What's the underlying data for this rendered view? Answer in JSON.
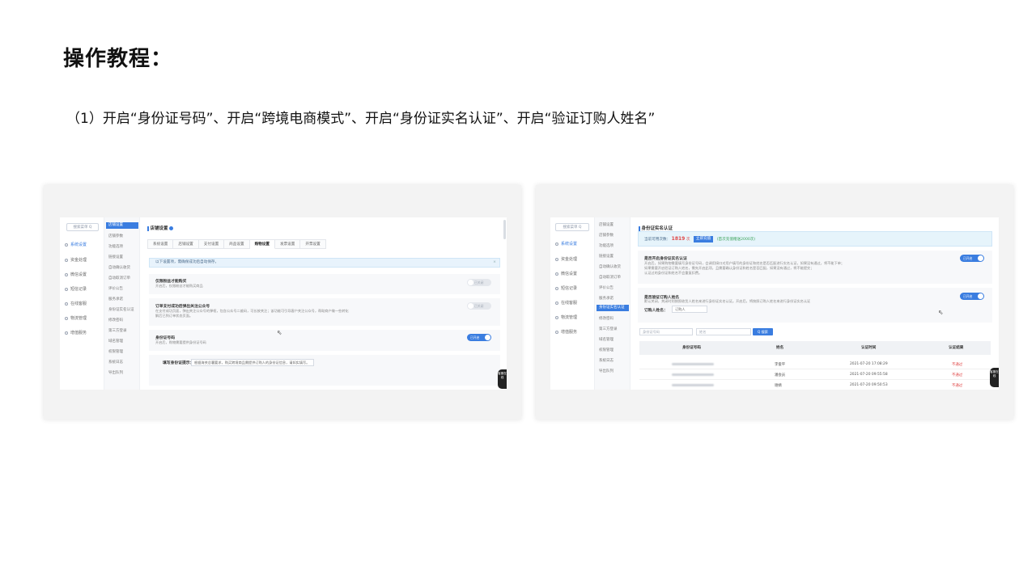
{
  "slide": {
    "title": "操作教程：",
    "subtitle": "（1）开启“身份证号码”、开启“跨境电商模式”、开启“身份证实名认证”、开启“验证订购人姓名”"
  },
  "left": {
    "search_placeholder": "搜索菜单 Q",
    "sidebar_primary": [
      "系统设置",
      "资金处理",
      "微信设置",
      "短信记录",
      "在线客服",
      "物流管理",
      "增值服务"
    ],
    "sidebar_secondary": [
      "店铺设置",
      "店铺参数",
      "功能选项",
      "链接设置",
      "自动确认收货",
      "自动取消订单",
      "评价公告",
      "服务承诺",
      "身份证实名认证",
      "修改密码",
      "第三方登录",
      "域名管理",
      "权限管理",
      "系统日志",
      "导出队列"
    ],
    "pane_title": "店铺设置",
    "tabs": [
      "系统设置",
      "店铺设置",
      "支付设置",
      "商品设置",
      "购物设置",
      "发票设置",
      "开票设置"
    ],
    "active_tab": "购物设置",
    "info": "以下设置项，需确保成功后自动保存。",
    "cards": [
      {
        "title": "仅限粉丝才能购买",
        "desc": "开启后，仅限粉丝才能购买商品",
        "toggle": "已关闭"
      },
      {
        "title": "订单支付成功后弹出关注公众号",
        "desc": "在支付成功页面，弹出关注公众号的弹框，包含公众号二维码，可长按关注；该功能可引导客户关注公众号，帮助商户做一些转化",
        "desc2": "解后已到订单状态页面。",
        "toggle": "已关闭"
      },
      {
        "title": "身份证号码",
        "desc": "开启后，购物需要提供身份证号码",
        "toggle": "已开启"
      }
    ],
    "fill_label": "填写身份证提示：",
    "fill_value": "根据海关总署要求，购买跨境商品需提供订购人的身份证信息，请如实填写。",
    "float_tab": "客服在线"
  },
  "right": {
    "search_placeholder": "搜索菜单 Q",
    "sidebar_primary": [
      "系统设置",
      "资金处理",
      "微信设置",
      "短信记录",
      "在线客服",
      "物流管理",
      "增值服务"
    ],
    "sidebar_secondary": [
      "店铺设置",
      "店铺参数",
      "功能选项",
      "链接设置",
      "自动确认收货",
      "自动取消订单",
      "评价公告",
      "服务承诺",
      "身份证实名认证",
      "修改密码",
      "第三方登录",
      "域名管理",
      "权限管理",
      "系统日志",
      "导出队列"
    ],
    "pane_title": "身份证实名认证",
    "quota_label": "当前可用次数：",
    "quota_value": "1819",
    "quota_unit": "次",
    "recharge_button": "立即充值",
    "quota_note": "(首次充值赠送2000次)",
    "cards": [
      {
        "title": "是否开启身份证实名认证",
        "desc": "开启后，如果购物需要填写身份证号码，会调用接口对用户填写的身份证和姓名是否匹配进行实名认证，如果没有通过，将不能下单；",
        "desc2": "如果需要开启验证订购人姓名，需先开启此项，且需要确认身份证和姓名是否匹配，如果没有通过，将不能提交；",
        "desc3": "认证过的身份证和姓名不会重复扣费。",
        "toggle": "已开启"
      },
      {
        "title": "是否验证订购人姓名",
        "desc": "默认关闭，关闭时则按照收货人姓名来进行身份证实名认证。开启后，将按照订购人姓名来进行身份证实名认证",
        "toggle": "已开启"
      }
    ],
    "buyer_label": "订购人姓名：",
    "buyer_value": "订购人",
    "filter_idcard_placeholder": "身份证号码",
    "filter_name_placeholder": "姓名",
    "search_button": "Q 搜索",
    "table_headers": [
      "身份证号码",
      "姓名",
      "认证时间",
      "认证结果"
    ],
    "table_rows": [
      {
        "name": "李俊平",
        "time": "2021-07-20 17:08:29",
        "result": "不通过"
      },
      {
        "name": "潘会员",
        "time": "2021-07-20 09:55:58",
        "result": "不通过"
      },
      {
        "name": "谢婧",
        "time": "2021-07-20 09:50:53",
        "result": "不通过"
      }
    ],
    "float_tab": "客服在线"
  },
  "colors": {
    "accent": "#3a7de0",
    "fail": "#e04848",
    "quota": "#e04848",
    "note": "#3aa35a"
  }
}
